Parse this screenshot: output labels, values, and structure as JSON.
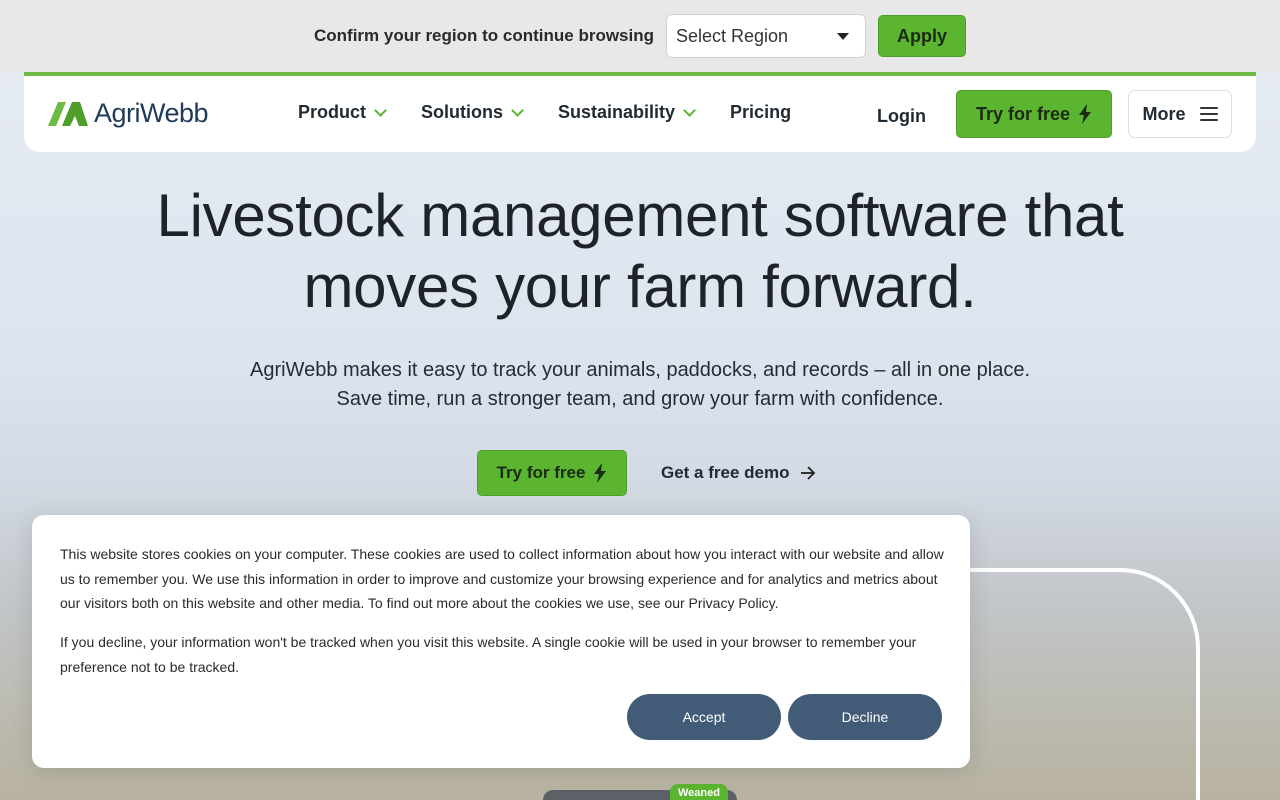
{
  "region_bar": {
    "prompt": "Confirm your region to continue browsing",
    "select_value": "Select Region",
    "apply_label": "Apply"
  },
  "header": {
    "logo_text": "AgriWebb",
    "nav": [
      "Product",
      "Solutions",
      "Sustainability",
      "Pricing"
    ],
    "login_label": "Login",
    "try_label": "Try for free",
    "more_label": "More"
  },
  "hero": {
    "title_line1": "Livestock management software that",
    "title_line2": "moves your farm forward.",
    "sub_line1": "AgriWebb makes it easy to track your animals, paddocks, and records – all in one place.",
    "sub_line2": "Save time, run a stronger team, and grow your farm with confidence.",
    "try_label": "Try for free",
    "demo_label": "Get a free demo"
  },
  "background": {
    "badge": "Weaned"
  },
  "cookie": {
    "para1": "This website stores cookies on your computer. These cookies are used to collect information about how you interact with our website and allow us to remember you. We use this information in order to improve and customize your browsing experience and for analytics and metrics about our visitors both on this website and other media. To find out more about the cookies we use, see our Privacy Policy.",
    "para2": "If you decline, your information won't be tracked when you visit this website. A single cookie will be used in your browser to remember your preference not to be tracked.",
    "accept_label": "Accept",
    "decline_label": "Decline"
  },
  "colors": {
    "brand_green": "#5cb531",
    "cookie_button": "#425b76",
    "logo_navy": "#1f3a5a"
  }
}
